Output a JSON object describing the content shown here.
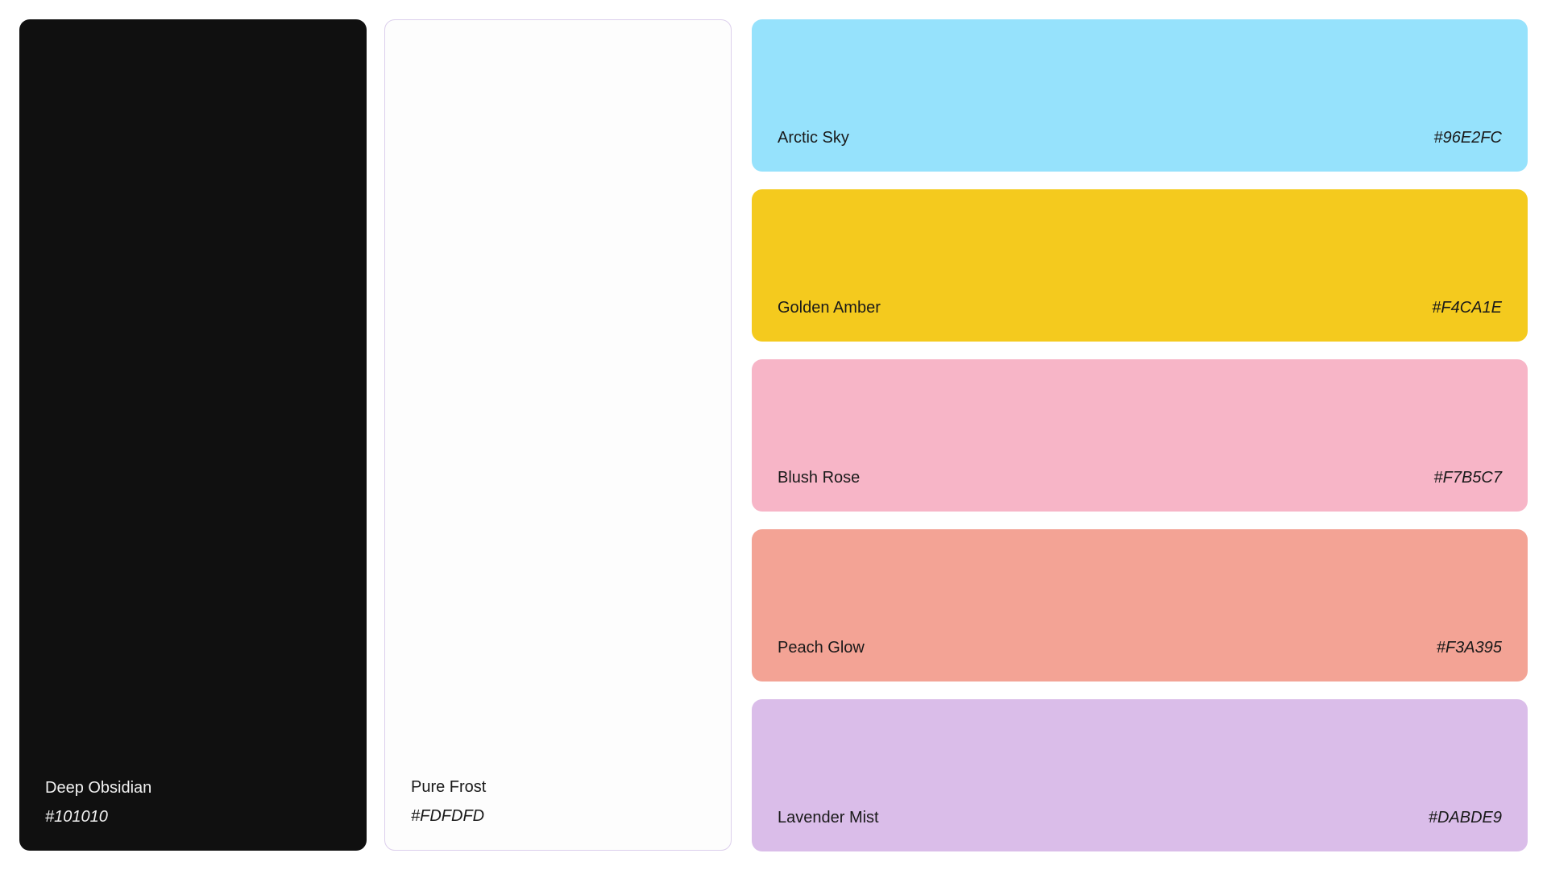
{
  "swatches": [
    {
      "name": "Deep Obsidian",
      "hex": "#101010",
      "color": "#101010",
      "text_color": "#F2F2F2"
    },
    {
      "name": "Pure Frost",
      "hex": "#FDFDFD",
      "color": "#FDFDFD",
      "text_color": "#1A1A1A"
    },
    {
      "name": "Arctic Sky",
      "hex": "#96E2FC",
      "color": "#96E2FC",
      "text_color": "#1A1A1A"
    },
    {
      "name": "Golden Amber",
      "hex": "#F4CA1E",
      "color": "#F4CA1E",
      "text_color": "#1A1A1A"
    },
    {
      "name": "Blush Rose",
      "hex": "#F7B5C7",
      "color": "#F7B5C7",
      "text_color": "#1A1A1A"
    },
    {
      "name": "Peach Glow",
      "hex": "#F3A395",
      "color": "#F3A395",
      "text_color": "#1A1A1A"
    },
    {
      "name": "Lavender Mist",
      "hex": "#DABDE9",
      "color": "#DABDE9",
      "text_color": "#1A1A1A"
    }
  ]
}
